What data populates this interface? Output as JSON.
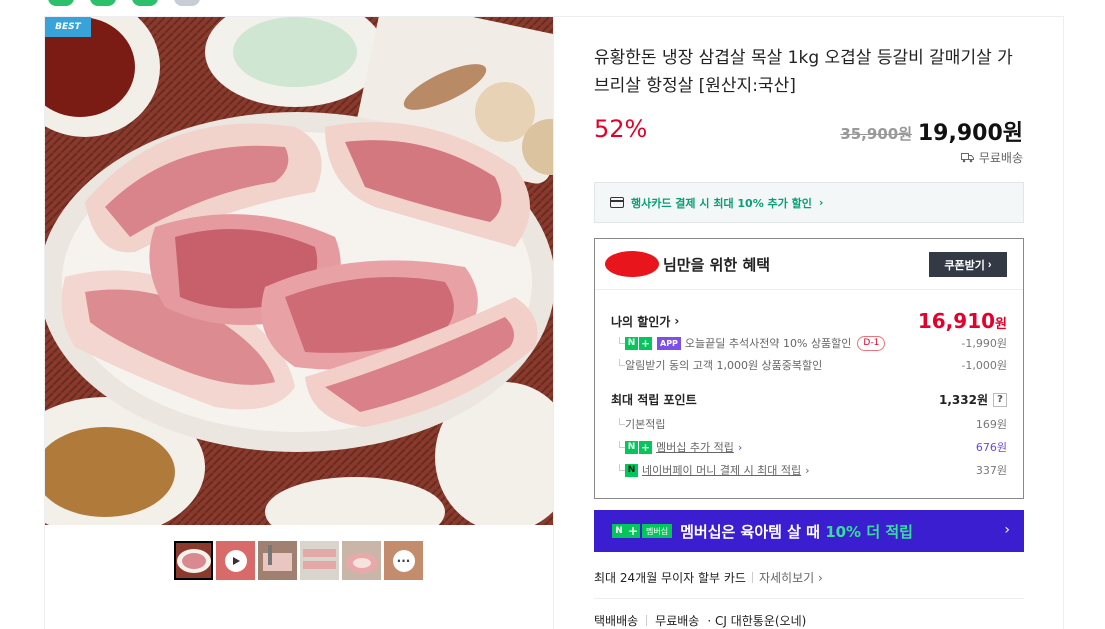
{
  "badge": "BEST",
  "product": {
    "title": "유황한돈 냉장 삼겹살 목살 1kg 오겹살 등갈비 갈매기살 가브리살 항정살 [원산지:국산]",
    "discount": "52%",
    "original_price": "35,900원",
    "sale_price": "19,900원",
    "shipping": "무료배송"
  },
  "card_promo": "행사카드 결제 시 최대 10% 추가 할인",
  "benefit": {
    "heading": "님만을 위한 혜택",
    "coupon_button": "쿠폰받기",
    "my_price_label": "나의 할인가",
    "my_price_value": "16,910",
    "my_price_unit": "원",
    "app_badge": "APP",
    "discount_item_1": "오늘끝딜 추석사전약 10% 상품할인",
    "d_badge": "D-1",
    "discount_item_1_value": "-1,990원",
    "discount_item_2": "알림받기 동의 고객 1,000원 상품중복할인",
    "discount_item_2_value": "-1,000원",
    "points_label": "최대 적립 포인트",
    "points_value": "1,332원",
    "points_help": "?",
    "basic_label": "기본적립",
    "basic_value": "169원",
    "membership_label": "멤버십 추가 적립",
    "membership_value": "676원",
    "naverpay_label": "네이버페이 머니 결제 시 최대 적립",
    "naverpay_value": "337원"
  },
  "member_banner": {
    "tag": "멤버십",
    "message": "멤버십은 육아템 살 때 ",
    "highlight": "10% 더 적립"
  },
  "installment": {
    "text": "최대 24개월 무이자 할부 카드",
    "more": "자세히보기"
  },
  "delivery": {
    "type": "택배배송",
    "fee": "무료배송",
    "carrier": "· CJ 대한통운(오네)"
  },
  "icons": [
    "card-icon",
    "truck-icon",
    "play-icon",
    "more-icon",
    "chevron-right-icon"
  ],
  "colors": {
    "accent_red": "#e4002b",
    "naver_green": "#03c75a",
    "membership_purple": "#3b1ed0"
  }
}
